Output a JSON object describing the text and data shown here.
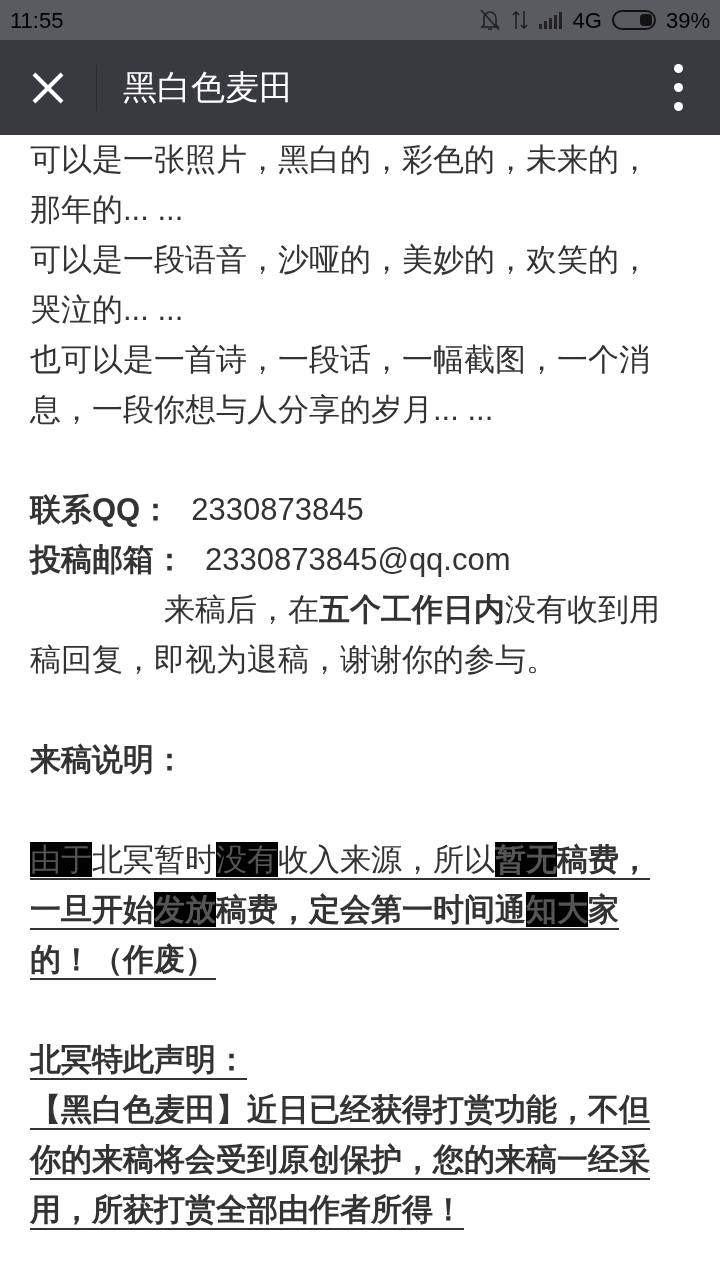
{
  "status_bar": {
    "time": "11:55",
    "network": "4G",
    "battery": "39%"
  },
  "header": {
    "title": "黑白色麦田"
  },
  "article": {
    "blocks": [
      {
        "kind": "text",
        "text": "可以是一张照片，黑白的，彩色的，未来的，那年的... ...",
        "bold": false,
        "underline": false
      },
      {
        "kind": "text",
        "text": "可以是一段语音，沙哑的，美妙的，欢笑的，哭泣的... ...",
        "bold": false,
        "underline": false
      },
      {
        "kind": "text",
        "text": "也可以是一首诗，一段话，一幅截图，一个消息，一段你想与人分享的岁月... ...",
        "bold": false,
        "underline": false
      },
      {
        "kind": "blank"
      },
      {
        "kind": "field",
        "label": "联系QQ：",
        "value": "2330873845"
      },
      {
        "kind": "field",
        "label": "投稿邮箱：",
        "value": "2330873845@qq.com"
      },
      {
        "kind": "indented",
        "text": "来稿后，在**五个工作日内**没有收到用稿回复，即视为退稿，谢谢你的参与。",
        "bold": false,
        "underline": false
      },
      {
        "kind": "blank"
      },
      {
        "kind": "text",
        "text": "来稿说明：",
        "bold": true,
        "underline": false
      },
      {
        "kind": "blank"
      },
      {
        "kind": "segments",
        "underline": true,
        "segments": [
          {
            "text": "由于",
            "highlight": true
          },
          {
            "text": "北冥暂时",
            "highlight": false
          },
          {
            "text": "没有",
            "highlight": true
          },
          {
            "text": "收入来源，所以",
            "highlight": false
          },
          {
            "text": "**暂无**",
            "highlight": true
          },
          {
            "text": "**稿费，一旦开始**",
            "highlight": false
          },
          {
            "text": "**发放**",
            "highlight": true
          },
          {
            "text": "**稿费，定会第一时间通**",
            "highlight": false
          },
          {
            "text": "**知大**",
            "highlight": true
          },
          {
            "text": "**家的！（作废）**",
            "highlight": false
          }
        ]
      },
      {
        "kind": "blank"
      },
      {
        "kind": "text",
        "text": "北冥特此声明：",
        "bold": true,
        "underline": true
      },
      {
        "kind": "text",
        "text": "【黑白色麦田】近日已经获得打赏功能，不但你的来稿将会受到原创保护，您的来稿一经采用，所获打赏全部由作者所得！",
        "bold": true,
        "underline": true
      }
    ]
  }
}
